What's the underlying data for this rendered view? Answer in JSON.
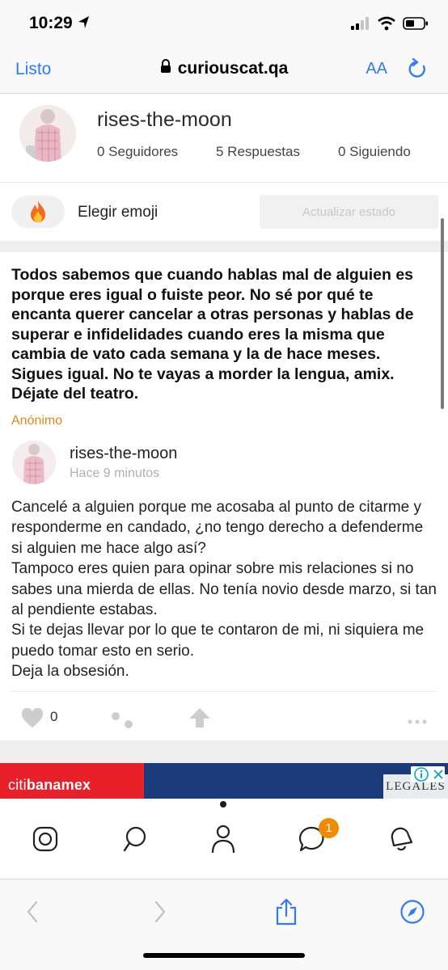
{
  "status_bar": {
    "time": "10:29"
  },
  "browser": {
    "done_label": "Listo",
    "domain": "curiouscat.qa",
    "text_size_label": "AA"
  },
  "profile": {
    "username": "rises-the-moon",
    "stats": [
      {
        "label": "0 Seguidores"
      },
      {
        "label": "5 Respuestas"
      },
      {
        "label": "0 Siguiendo"
      }
    ]
  },
  "status_editor": {
    "emoji": "🔥",
    "choose_label": "Elegir emoji",
    "update_label": "Actualizar estado"
  },
  "post": {
    "question": "Todos sabemos que cuando hablas mal de alguien es porque eres igual o fuiste peor. No sé por qué te encanta querer  cancelar a otras personas y hablas de superar e infidelidades cuando eres la misma que cambia de vato cada semana y la de hace meses. Sigues igual. No te vayas a morder la lengua, amix. Déjate del teatro.",
    "asker": "Anónimo",
    "answerer": "rises-the-moon",
    "time_ago": "Hace 9 minutos",
    "answer": "Cancelé a alguien porque me acosaba al punto de citarme y responderme en candado, ¿no tengo derecho a defenderme si alguien me hace algo así?\nTampoco eres quien para opinar sobre mis relaciones si no sabes una mierda de ellas. No tenía novio desde marzo, si tan al pendiente estabas.\nSi te dejas llevar por lo que te contaron de mi, ni siquiera me puedo tomar esto en serio.\nDeja la obsesión.",
    "likes": "0"
  },
  "ad": {
    "brand_prefix": "citi",
    "brand_suffix": "banamex",
    "right_text": "LEGALES"
  },
  "app_nav": {
    "messages_badge": "1"
  },
  "colors": {
    "link_blue": "#2f7cf6",
    "anon_orange": "#e08a18",
    "badge_orange": "#f08a00"
  }
}
